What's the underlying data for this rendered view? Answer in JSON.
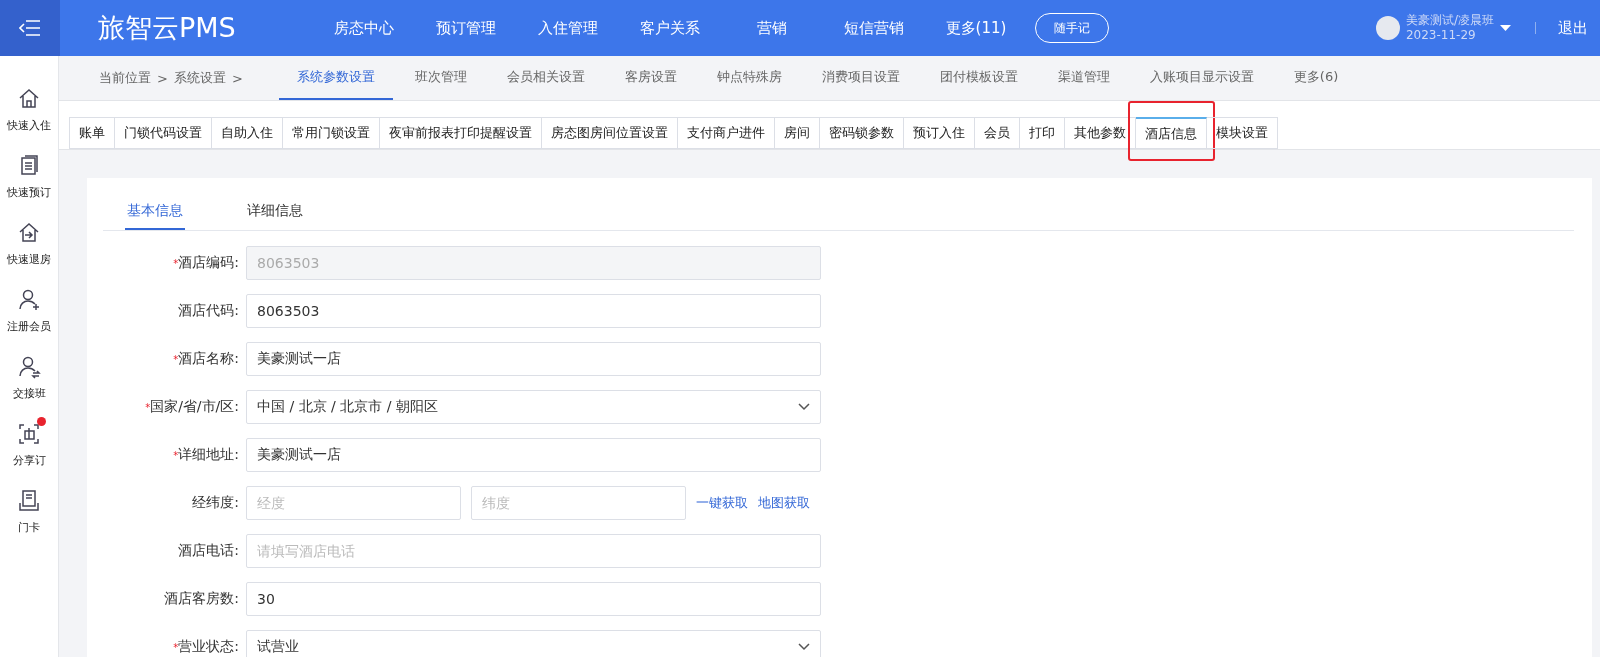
{
  "header": {
    "brand": "旅智云PMS",
    "nav": [
      {
        "label": "房态中心"
      },
      {
        "label": "预订管理"
      },
      {
        "label": "入住管理"
      },
      {
        "label": "客户关系"
      },
      {
        "label": "营销"
      },
      {
        "label": "短信营销"
      },
      {
        "label": "更多(11)"
      }
    ],
    "note_button": "随手记",
    "user": {
      "name": "美豪测试/凌晨班",
      "date": "2023-11-29"
    },
    "logout": "退出"
  },
  "sidebar": [
    {
      "label": "快速入住",
      "badge": false
    },
    {
      "label": "快速预订",
      "badge": false
    },
    {
      "label": "快速退房",
      "badge": false
    },
    {
      "label": "注册会员",
      "badge": false
    },
    {
      "label": "交接班",
      "badge": false
    },
    {
      "label": "分享订",
      "badge": true
    },
    {
      "label": "门卡",
      "badge": false
    }
  ],
  "breadcrumb": [
    {
      "label": "当前位置",
      "separator": ">"
    },
    {
      "label": "系统设置",
      "separator": ">"
    }
  ],
  "subnav": [
    {
      "label": "系统参数设置",
      "selected": true
    },
    {
      "label": "班次管理",
      "selected": false
    },
    {
      "label": "会员相关设置",
      "selected": false
    },
    {
      "label": "客房设置",
      "selected": false
    },
    {
      "label": "钟点特殊房",
      "selected": false
    },
    {
      "label": "消费项目设置",
      "selected": false
    },
    {
      "label": "团付模板设置",
      "selected": false
    },
    {
      "label": "渠道管理",
      "selected": false
    },
    {
      "label": "入账项目显示设置",
      "selected": false
    },
    {
      "label": "更多(6)",
      "selected": false
    }
  ],
  "tabs": [
    {
      "label": "账单",
      "selected": false
    },
    {
      "label": "门锁代码设置",
      "selected": false
    },
    {
      "label": "自助入住",
      "selected": false
    },
    {
      "label": "常用门锁设置",
      "selected": false
    },
    {
      "label": "夜审前报表打印提醒设置",
      "selected": false
    },
    {
      "label": "房态图房间位置设置",
      "selected": false
    },
    {
      "label": "支付商户进件",
      "selected": false
    },
    {
      "label": "房间",
      "selected": false
    },
    {
      "label": "密码锁参数",
      "selected": false
    },
    {
      "label": "预订入住",
      "selected": false
    },
    {
      "label": "会员",
      "selected": false
    },
    {
      "label": "打印",
      "selected": false
    },
    {
      "label": "其他参数",
      "selected": false
    },
    {
      "label": "酒店信息",
      "selected": true,
      "highlighted": true
    },
    {
      "label": "模块设置",
      "selected": false
    }
  ],
  "inner_tabs": [
    {
      "label": "基本信息",
      "selected": true
    },
    {
      "label": "详细信息",
      "selected": false
    }
  ],
  "form": [
    {
      "kind": "input",
      "label": "酒店编码:",
      "required_mark": "*",
      "value": "8063503",
      "disabled": true
    },
    {
      "kind": "input",
      "label": "酒店代码:",
      "value": "8063503",
      "disabled": false
    },
    {
      "kind": "input",
      "label": "酒店名称:",
      "required_mark": "*",
      "value": "美豪测试一店",
      "disabled": false
    },
    {
      "kind": "select",
      "label": "国家/省/市/区:",
      "required_mark": "*",
      "value": "中国 / 北京 / 北京市 / 朝阳区"
    },
    {
      "kind": "input",
      "label": "详细地址:",
      "required_mark": "*",
      "value": "美豪测试一店",
      "disabled": false
    },
    {
      "kind": "pair",
      "label": "经纬度:",
      "placeholders": [
        "经度",
        "纬度"
      ],
      "links": [
        "一键获取",
        "地图获取"
      ]
    },
    {
      "kind": "input",
      "label": "酒店电话:",
      "placeholder": "请填写酒店电话"
    },
    {
      "kind": "input",
      "label": "酒店客房数:",
      "value": "30",
      "disabled": false
    },
    {
      "kind": "select",
      "label": "营业状态:",
      "required_mark": "*",
      "value": "试营业"
    }
  ]
}
